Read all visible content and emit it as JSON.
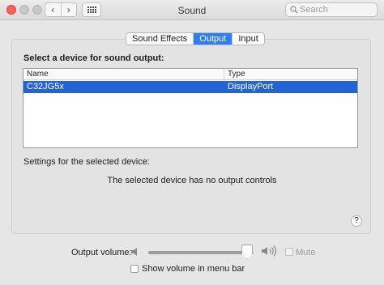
{
  "window": {
    "title": "Sound",
    "back_glyph": "‹",
    "forward_glyph": "›",
    "search_placeholder": "Search"
  },
  "tabs": [
    {
      "label": "Sound Effects",
      "active": false
    },
    {
      "label": "Output",
      "active": true
    },
    {
      "label": "Input",
      "active": false
    }
  ],
  "output": {
    "section_title": "Select a device for sound output:",
    "columns": [
      "Name",
      "Type"
    ],
    "devices": [
      {
        "name": "C32JG5x",
        "type": "DisplayPort",
        "selected": true
      }
    ],
    "settings_label": "Settings for the selected device:",
    "no_controls_text": "The selected device has no output controls",
    "help_glyph": "?"
  },
  "volume": {
    "label": "Output volume:",
    "level_fraction": 0.94,
    "mute_label": "Mute",
    "mute_checked": false,
    "mute_enabled": false,
    "show_in_menu_bar_label": "Show volume in menu bar",
    "show_in_menu_bar_checked": false
  },
  "colors": {
    "accent": "#2d7ef5",
    "selection": "#2463d6",
    "close": "#fe5f57"
  },
  "icons": [
    "close-icon",
    "minimize-icon",
    "zoom-icon",
    "back-icon",
    "forward-icon",
    "show-all-grid-icon",
    "search-icon",
    "speaker-low-icon",
    "speaker-high-icon",
    "help-icon"
  ]
}
